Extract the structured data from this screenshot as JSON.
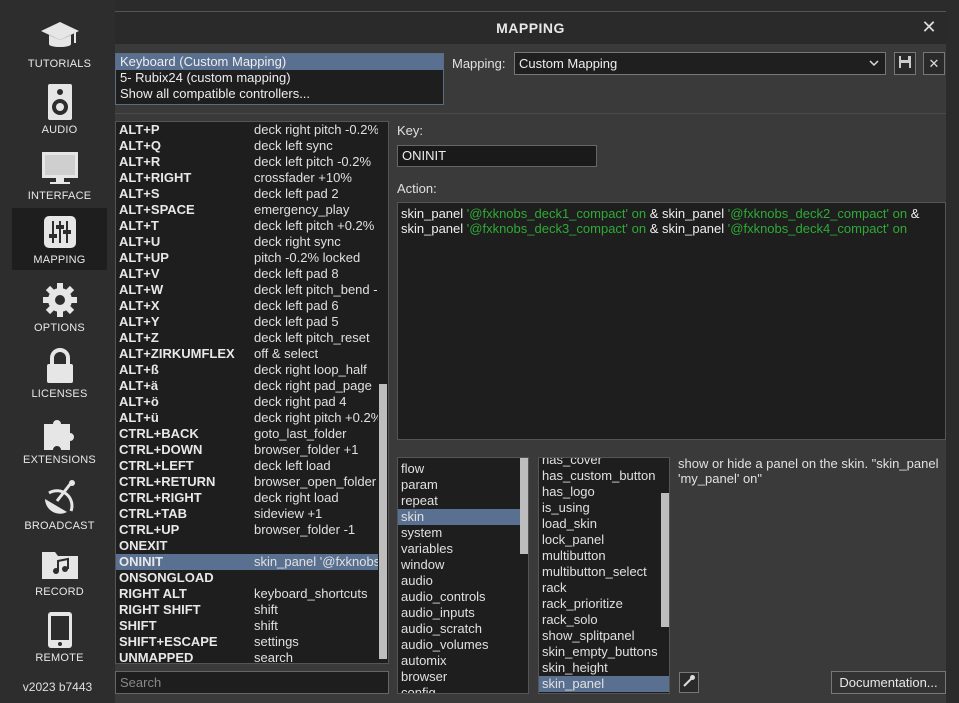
{
  "sidebar": {
    "items": [
      {
        "label": "TUTORIALS",
        "icon": "graduation-cap-icon"
      },
      {
        "label": "AUDIO",
        "icon": "speaker-icon"
      },
      {
        "label": "INTERFACE",
        "icon": "monitor-icon"
      },
      {
        "label": "MAPPING",
        "icon": "sliders-icon",
        "active": true
      },
      {
        "label": "OPTIONS",
        "icon": "gear-icon"
      },
      {
        "label": "LICENSES",
        "icon": "lock-icon"
      },
      {
        "label": "EXTENSIONS",
        "icon": "puzzle-icon"
      },
      {
        "label": "BROADCAST",
        "icon": "satellite-dish-icon"
      },
      {
        "label": "RECORD",
        "icon": "music-folder-icon"
      },
      {
        "label": "REMOTE",
        "icon": "phone-icon"
      }
    ],
    "version": "v2023 b7443"
  },
  "window": {
    "title": "MAPPING",
    "close": "✕"
  },
  "controllers": [
    {
      "label": "Keyboard (Custom Mapping)",
      "selected": true
    },
    {
      "label": "5- Rubix24 (custom mapping)",
      "selected": false
    },
    {
      "label": "Show all compatible controllers...",
      "selected": false
    }
  ],
  "mapping": {
    "label": "Mapping:",
    "value": "Custom Mapping"
  },
  "keys": [
    {
      "key": "ALT+P",
      "action": "deck right pitch -0.2%"
    },
    {
      "key": "ALT+Q",
      "action": "deck left sync"
    },
    {
      "key": "ALT+R",
      "action": "deck left pitch -0.2%"
    },
    {
      "key": "ALT+RIGHT",
      "action": "crossfader +10%"
    },
    {
      "key": "ALT+S",
      "action": "deck left pad 2"
    },
    {
      "key": "ALT+SPACE",
      "action": "emergency_play"
    },
    {
      "key": "ALT+T",
      "action": "deck left pitch +0.2%"
    },
    {
      "key": "ALT+U",
      "action": "deck right sync"
    },
    {
      "key": "ALT+UP",
      "action": "pitch -0.2% locked"
    },
    {
      "key": "ALT+V",
      "action": "deck left pad 8"
    },
    {
      "key": "ALT+W",
      "action": "deck left pitch_bend -"
    },
    {
      "key": "ALT+X",
      "action": "deck left pad 6"
    },
    {
      "key": "ALT+Y",
      "action": "deck left pad 5"
    },
    {
      "key": "ALT+Z",
      "action": "deck left pitch_reset"
    },
    {
      "key": "ALT+ZIRKUMFLEX",
      "action": "off & select"
    },
    {
      "key": "ALT+ß",
      "action": "deck right loop_half"
    },
    {
      "key": "ALT+ä",
      "action": "deck right pad_page"
    },
    {
      "key": "ALT+ö",
      "action": "deck right pad 4"
    },
    {
      "key": "ALT+ü",
      "action": "deck right pitch +0.2%"
    },
    {
      "key": "CTRL+BACK",
      "action": "goto_last_folder"
    },
    {
      "key": "CTRL+DOWN",
      "action": "browser_folder +1"
    },
    {
      "key": "CTRL+LEFT",
      "action": "deck left load"
    },
    {
      "key": "CTRL+RETURN",
      "action": "browser_open_folder"
    },
    {
      "key": "CTRL+RIGHT",
      "action": "deck right load"
    },
    {
      "key": "CTRL+TAB",
      "action": "sideview +1"
    },
    {
      "key": "CTRL+UP",
      "action": "browser_folder -1"
    },
    {
      "key": "ONEXIT",
      "action": ""
    },
    {
      "key": "ONINIT",
      "action": "skin_panel '@fxknobs_deck1_compact' on",
      "selected": true
    },
    {
      "key": "ONSONGLOAD",
      "action": ""
    },
    {
      "key": "RIGHT ALT",
      "action": "keyboard_shortcuts"
    },
    {
      "key": "RIGHT SHIFT",
      "action": "shift"
    },
    {
      "key": "SHIFT",
      "action": "shift"
    },
    {
      "key": "SHIFT+ESCAPE",
      "action": "settings"
    },
    {
      "key": "UNMAPPED",
      "action": "search"
    }
  ],
  "search": {
    "placeholder": "Search"
  },
  "key_field": {
    "label": "Key:",
    "value": "ONINIT"
  },
  "action_field": {
    "label": "Action:",
    "parts": [
      {
        "text": "skin_panel ",
        "type": "code"
      },
      {
        "text": "'@fxknobs_deck1_compact' on",
        "type": "string"
      },
      {
        "text": " & skin_panel ",
        "type": "code"
      },
      {
        "text": "'@fxknobs_deck2_compact' on",
        "type": "string"
      },
      {
        "text": " & skin_panel ",
        "type": "code"
      },
      {
        "text": "'@fxknobs_deck3_compact' on",
        "type": "string"
      },
      {
        "text": " & skin_panel ",
        "type": "code"
      },
      {
        "text": "'@fxknobs_deck4_compact' on",
        "type": "string"
      }
    ]
  },
  "categories": [
    {
      "label": "flow"
    },
    {
      "label": "param"
    },
    {
      "label": "repeat"
    },
    {
      "label": "skin",
      "selected": true
    },
    {
      "label": "system"
    },
    {
      "label": "variables"
    },
    {
      "label": "window"
    },
    {
      "label": "audio"
    },
    {
      "label": "audio_controls"
    },
    {
      "label": "audio_inputs"
    },
    {
      "label": "audio_scratch"
    },
    {
      "label": "audio_volumes"
    },
    {
      "label": "automix"
    },
    {
      "label": "browser"
    },
    {
      "label": "config"
    }
  ],
  "verbs": [
    {
      "label": "has_cover"
    },
    {
      "label": "has_custom_button"
    },
    {
      "label": "has_logo"
    },
    {
      "label": "is_using"
    },
    {
      "label": "load_skin"
    },
    {
      "label": "lock_panel"
    },
    {
      "label": "multibutton"
    },
    {
      "label": "multibutton_select"
    },
    {
      "label": "rack"
    },
    {
      "label": "rack_prioritize"
    },
    {
      "label": "rack_solo"
    },
    {
      "label": "show_splitpanel"
    },
    {
      "label": "skin_empty_buttons"
    },
    {
      "label": "skin_height"
    },
    {
      "label": "skin_panel",
      "selected": true
    }
  ],
  "help": {
    "text": "show or hide a panel on the skin. \"skin_panel 'my_panel' on\""
  },
  "buttons": {
    "documentation": "Documentation...",
    "save": "save-icon",
    "delete": "✕"
  }
}
